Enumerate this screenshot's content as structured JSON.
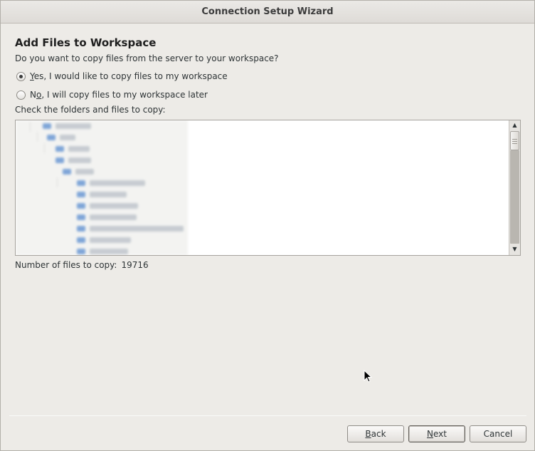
{
  "window": {
    "title": "Connection Setup Wizard"
  },
  "page": {
    "heading": "Add Files to Workspace",
    "question": "Do you want to copy files from the server to your workspace?",
    "options": [
      {
        "mnemonic": "Y",
        "rest": "es, I would like to copy files to my workspace",
        "checked": true
      },
      {
        "pre": "N",
        "mnemonic": "o",
        "rest": ", I will copy files to my workspace later",
        "checked": false
      }
    ],
    "tree_label": "Check the folders and files to copy:",
    "count_label": "Number of files to copy:",
    "count_value": "19716"
  },
  "buttons": {
    "back": {
      "mnemonic": "B",
      "rest": "ack"
    },
    "next": {
      "mnemonic": "N",
      "rest": "ext"
    },
    "cancel": "Cancel"
  },
  "icons": {
    "scroll_up": "scroll-up-arrow-icon",
    "scroll_down": "scroll-down-arrow-icon",
    "cursor": "mouse-pointer-icon"
  },
  "colors": {
    "window_bg": "#edebe7",
    "folder": "#7fa6d8"
  }
}
